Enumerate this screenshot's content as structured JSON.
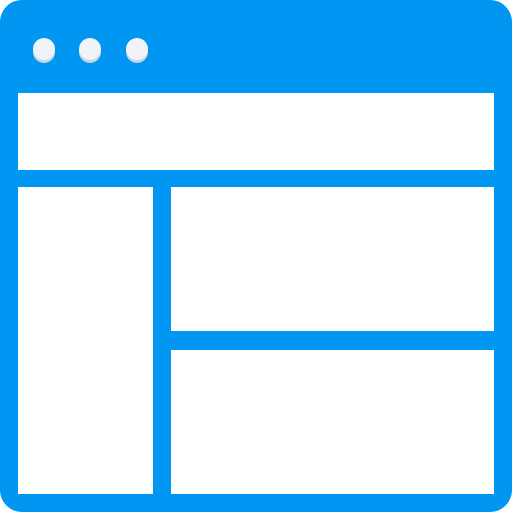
{
  "icon": {
    "name": "browser-window-layout-icon",
    "colors": {
      "frame": "#0096F2",
      "content": "#FFFFFF",
      "dot": "#F0F4F8",
      "dot_shadow": "#CAD6E0"
    },
    "window_controls": [
      "dot-1",
      "dot-2",
      "dot-3"
    ],
    "panels": [
      "header-panel",
      "sidebar-panel",
      "main-top-panel",
      "main-bottom-panel"
    ]
  }
}
